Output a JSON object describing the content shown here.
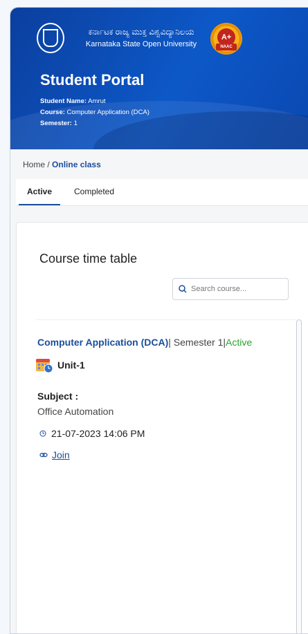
{
  "header": {
    "university_name_kannada": "ಕರ್ನಾಟಕ ರಾಜ್ಯ ಮುಕ್ತ ವಿಶ್ವವಿದ್ಯಾನಿಲಯ",
    "university_name_english": "Karnataka State Open University",
    "naac_grade": "A+",
    "naac_label": "NAAC",
    "portal_title": "Student Portal",
    "student_name_label": "Student Name:",
    "student_name": "Amrut",
    "course_label": "Course:",
    "course": "Computer Application (DCA)",
    "semester_label": "Semester:",
    "semester": "1"
  },
  "breadcrumb": {
    "home": "Home",
    "separator": "/",
    "current": "Online class"
  },
  "tabs": [
    {
      "label": "Active",
      "active": true
    },
    {
      "label": "Completed",
      "active": false
    }
  ],
  "timetable": {
    "title": "Course time table",
    "search_placeholder": "Search course...",
    "course_name": "Computer Application (DCA)",
    "semester_text": "| Semester 1|",
    "status": "Active",
    "unit": "Unit-1",
    "subject_label": "Subject :",
    "subject_value": "Office Automation",
    "datetime": "21-07-2023 14:06 PM",
    "join_label": "Join"
  },
  "colors": {
    "header_blue": "#0d58c8",
    "link_blue": "#1a4e9c",
    "active_green": "#2aa52a"
  }
}
